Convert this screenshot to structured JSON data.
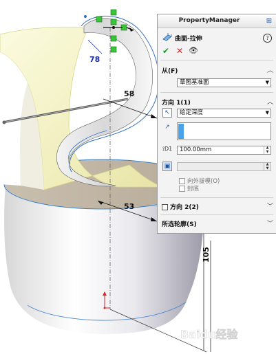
{
  "viewport": {
    "dimensions": [
      "58",
      "53",
      "105",
      "78"
    ],
    "watermark": "Baidu经验"
  },
  "property_manager": {
    "title": "PropertyManager",
    "pin_icon": "pin-icon",
    "feature_name": "曲面-拉伸",
    "help": "?",
    "ok": "✔",
    "cancel": "✕",
    "from": {
      "label": "从(F)",
      "value": "草图基准面"
    },
    "direction1": {
      "label": "方向 1(1)",
      "end_condition": "给定深度",
      "depth": "100.00mm",
      "draft_outward": "向外拔模(O)",
      "cap_end": "封底"
    },
    "direction2": {
      "label": "方向 2(2)"
    },
    "selected_contours": {
      "label": "所选轮廓(S)"
    }
  }
}
